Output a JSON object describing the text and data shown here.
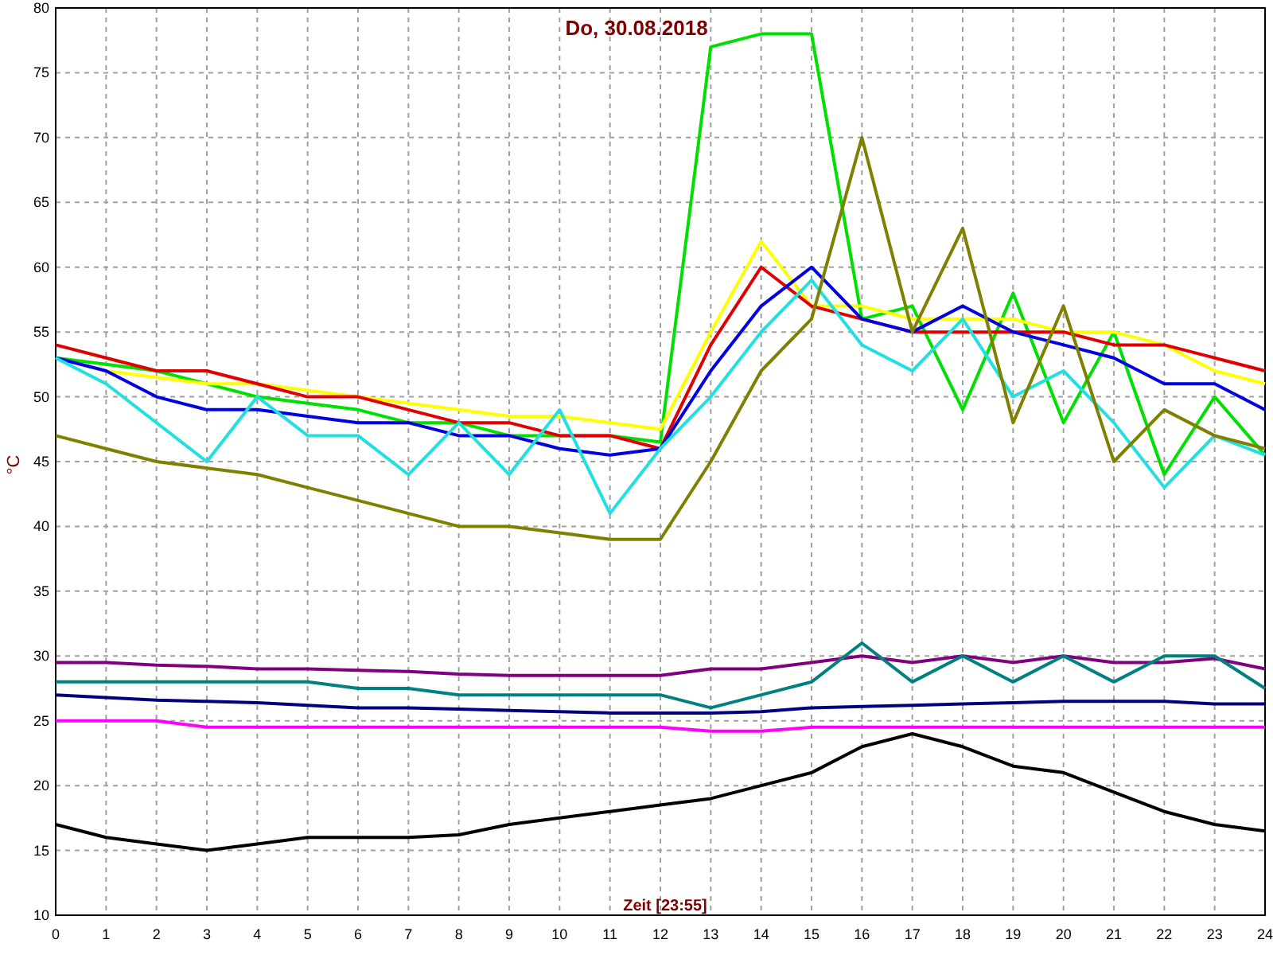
{
  "chart": {
    "chart_data": {
      "type": "line",
      "title": "Do, 30.08.2018",
      "xlabel": "Zeit [23:55]",
      "ylabel": "°C",
      "x": [
        0,
        1,
        2,
        3,
        4,
        5,
        6,
        7,
        8,
        9,
        10,
        11,
        12,
        13,
        14,
        15,
        16,
        17,
        18,
        19,
        20,
        21,
        22,
        23,
        24
      ],
      "grid": true,
      "xlim": [
        0,
        24
      ],
      "ylim": [
        10,
        80
      ],
      "xticks": [
        0,
        1,
        2,
        3,
        4,
        5,
        6,
        7,
        8,
        9,
        10,
        11,
        12,
        13,
        14,
        15,
        16,
        17,
        18,
        19,
        20,
        21,
        22,
        23,
        24
      ],
      "yticks": [
        10,
        15,
        20,
        25,
        30,
        35,
        40,
        45,
        50,
        55,
        60,
        65,
        70,
        75,
        80
      ],
      "series": [
        {
          "color": "#00e000",
          "values": [
            53,
            52.5,
            52,
            51,
            50,
            49.5,
            49,
            48,
            48,
            47,
            47,
            47,
            46.5,
            77,
            78,
            78,
            56,
            57,
            49,
            58,
            48,
            55,
            44,
            50,
            45.5
          ]
        },
        {
          "color": "#ffff00",
          "values": [
            null,
            52,
            51.5,
            51,
            51,
            50.5,
            50,
            49.5,
            49,
            48.5,
            48.5,
            48,
            47.5,
            55,
            62,
            57,
            57,
            56,
            56,
            56,
            55,
            55,
            54,
            52,
            51
          ]
        },
        {
          "color": "#e00000",
          "values": [
            54,
            53,
            52,
            52,
            51,
            50,
            50,
            49,
            48,
            48,
            47,
            47,
            46,
            54,
            60,
            57,
            56,
            55,
            55,
            55,
            55,
            54,
            54,
            53,
            52
          ]
        },
        {
          "color": "#0000e0",
          "values": [
            53,
            52,
            50,
            49,
            49,
            48.5,
            48,
            48,
            47,
            47,
            46,
            45.5,
            46,
            52,
            57,
            60,
            56,
            55,
            57,
            55,
            54,
            53,
            51,
            51,
            49
          ]
        },
        {
          "color": "#20e0e0",
          "values": [
            53,
            51,
            48,
            45,
            50,
            47,
            47,
            44,
            48,
            44,
            49,
            41,
            46,
            50,
            55,
            59,
            54,
            52,
            56,
            50,
            52,
            48,
            43,
            47,
            45.5
          ]
        },
        {
          "color": "#808000",
          "values": [
            47,
            46,
            45,
            44.5,
            44,
            43,
            42,
            41,
            40,
            40,
            39.5,
            39,
            39,
            45,
            52,
            56,
            70,
            55,
            63,
            48,
            57,
            45,
            49,
            47,
            46
          ]
        },
        {
          "color": "#800080",
          "values": [
            29.5,
            29.5,
            29.3,
            29.2,
            29,
            29,
            28.9,
            28.8,
            28.6,
            28.5,
            28.5,
            28.5,
            28.5,
            29,
            29,
            29.5,
            30,
            29.5,
            30,
            29.5,
            30,
            29.5,
            29.5,
            29.8,
            29
          ]
        },
        {
          "color": "#008080",
          "values": [
            28,
            28,
            28,
            28,
            28,
            28,
            27.5,
            27.5,
            27,
            27,
            27,
            27,
            27,
            26,
            27,
            28,
            31,
            28,
            30,
            28,
            30,
            28,
            30,
            30,
            27.5
          ]
        },
        {
          "color": "#000080",
          "values": [
            27,
            26.8,
            26.6,
            26.5,
            26.4,
            26.2,
            26,
            26,
            25.9,
            25.8,
            25.7,
            25.6,
            25.6,
            25.6,
            25.7,
            26,
            26.1,
            26.2,
            26.3,
            26.4,
            26.5,
            26.5,
            26.5,
            26.3,
            26.3
          ]
        },
        {
          "color": "#ff00ff",
          "values": [
            25,
            25,
            25,
            24.5,
            24.5,
            24.5,
            24.5,
            24.5,
            24.5,
            24.5,
            24.5,
            24.5,
            24.5,
            24.2,
            24.2,
            24.5,
            24.5,
            24.5,
            24.5,
            24.5,
            24.5,
            24.5,
            24.5,
            24.5,
            24.5
          ]
        },
        {
          "color": "#000000",
          "values": [
            17,
            16,
            15.5,
            15,
            15.5,
            16,
            16,
            16,
            16.2,
            17,
            17.5,
            18,
            18.5,
            19,
            20,
            21,
            23,
            24,
            23,
            21.5,
            21,
            19.5,
            18,
            17,
            16.5
          ]
        }
      ]
    }
  }
}
